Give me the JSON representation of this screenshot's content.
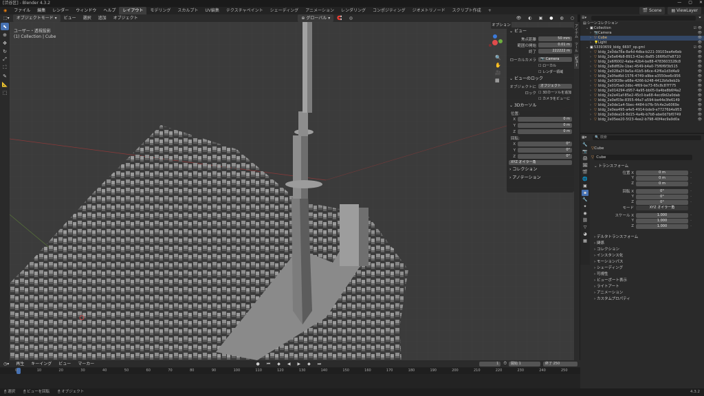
{
  "title": "[渋谷区] - Blender 4.3.2",
  "menu": [
    "ファイル",
    "編集",
    "レンダー",
    "ウィンドウ",
    "ヘルプ"
  ],
  "workspaces": [
    "レイアウト",
    "モデリング",
    "スカルプト",
    "UV編集",
    "テクスチャペイント",
    "シェーディング",
    "アニメーション",
    "レンダリング",
    "コンポジティング",
    "ジオメトリノード",
    "スクリプト作成"
  ],
  "active_workspace": "レイアウト",
  "scene": "Scene",
  "viewlayer": "ViewLayer",
  "viewport_header": {
    "mode": "オブジェクトモード",
    "items": [
      "ビュー",
      "選択",
      "追加",
      "オブジェクト"
    ],
    "transform": "グローバル",
    "options": "オプション"
  },
  "viewport_info": {
    "line1": "ユーザー・透視投影",
    "line2": "(1) Collection | Cube"
  },
  "npanel": {
    "view_header": "ビュー",
    "focal_label": "焦点距離",
    "focal_value": "50 mm",
    "clip_start_label": "範囲の開始",
    "clip_start_value": "0.01 m",
    "clip_end_label": "終了",
    "clip_end_value": "222222 m",
    "local_camera_label": "ローカルカメラ",
    "local_camera_value": "Camera",
    "local_check": "ローカル",
    "render_region": "レンダー領域",
    "view_lock_header": "ビューのロック",
    "lock_object_label": "オブジェクトに",
    "lock_object_value": "オブジェクト",
    "lock_label": "ロック",
    "lock_3d_cursor": "3Dカーソルを追加",
    "lock_camera": "カメラをビューに",
    "cursor_header": "3Dカーソル",
    "location_label": "位置:",
    "loc_x": "0 m",
    "loc_y": "0 m",
    "loc_z": "0 m",
    "rotation_label": "回転:",
    "rot_x": "0°",
    "rot_y": "0°",
    "rot_z": "0°",
    "rot_mode": "XYZ オイラー角",
    "collection_header": "コレクション",
    "annotation_header": "アノテーション",
    "axis_x": "X",
    "axis_y": "Y",
    "axis_z": "Z"
  },
  "sidetabs": [
    "アイテム",
    "ツール",
    "ビュー"
  ],
  "outliner": {
    "header": "シーンコレクション",
    "collection": "Collection",
    "items": [
      "Camera",
      "Cube",
      "Light"
    ],
    "group": "53393659_bldg_6697_op.gml",
    "buildings": [
      "bldg_2e0da78a-8a4d-4dba-b221-39103ea4e6eb",
      "bldg_2e5e64b8-8913-42ec-8a85-166f6d7e8710",
      "bldg_2e6f6002-4abe-42b4-be88-4783603328c8",
      "bldg_2e8df82e-1bac-4549-b4a0-75f6f6f3b515",
      "bldg_2e028a2f-9a5a-41b5-b6ce-42f6a1d3d4a9",
      "bldg_2e0fad6d-1576-4749-a9be-a3550ee6c956",
      "bldg_2e03f28e-a68e-4266-b248-4412bfa9eb2b",
      "bldg_2e01f5ad-2dbc-4f69-be73-65c8c87f775",
      "bldg_2e014294-d957-4a95-bb05-0a4be8b6f4a2",
      "bldg_2e2e41af-85e2-45c0-ba68-4ecd9d2a0dab",
      "bldg_2e0ef03e-8355-44a7-a594-be44e3fe6149",
      "bldg_2e0de1a4-5bec-4484-b7fb-5fc4e2e6069e",
      "bldg_2e0ea495-a4e5-4914-bde9-e77276b4a953",
      "bldg_2e0dea16-8d15-4a4b-b7b8-abe0d7bf0749",
      "bldg_2e05ee20-5f23-4ee2-b798-40f4ec9a9d0a"
    ]
  },
  "properties": {
    "search_placeholder": "検索",
    "object_name_small": "Cube",
    "object_name": "Cube",
    "transform_header": "トランスフォーム",
    "location_label": "位置 X",
    "loc_x": "0 m",
    "loc_y": "0 m",
    "loc_z": "0 m",
    "rotation_label": "回転 X",
    "rot_x": "0°",
    "rot_y": "0°",
    "rot_z": "0°",
    "mode_label": "モード",
    "mode_value": "XYZ オイラー角",
    "scale_label": "スケール X",
    "scale_x": "1.000",
    "scale_y": "1.000",
    "scale_z": "1.000",
    "axis_y": "Y",
    "axis_z": "Z",
    "sections": [
      "デルタトランスフォーム",
      "関係",
      "コレクション",
      "インスタンス化",
      "モーションパス",
      "シェーディング",
      "可視性",
      "ビューポート表示",
      "ライトアート",
      "アニメーション",
      "カスタムプロパティ"
    ]
  },
  "timeline": {
    "menus": [
      "再生",
      "キーイング",
      "ビュー",
      "マーカー"
    ],
    "current_frame": "1",
    "start_label": "開始",
    "start": "1",
    "end_label": "終了",
    "end": "250",
    "ticks": [
      "0",
      "10",
      "20",
      "30",
      "40",
      "50",
      "60",
      "70",
      "80",
      "90",
      "100",
      "110",
      "120",
      "130",
      "140",
      "150",
      "160",
      "170",
      "180",
      "190",
      "200",
      "210",
      "220",
      "230",
      "240",
      "250"
    ]
  },
  "statusbar": {
    "left": "選択",
    "mid1": "ビューを回転",
    "mid2": "オブジェクト",
    "version": "4.3.2"
  },
  "colors": {
    "accent": "#4772b3",
    "viewport_bg": "#3a3a3a",
    "building": "#8a8a8a"
  }
}
